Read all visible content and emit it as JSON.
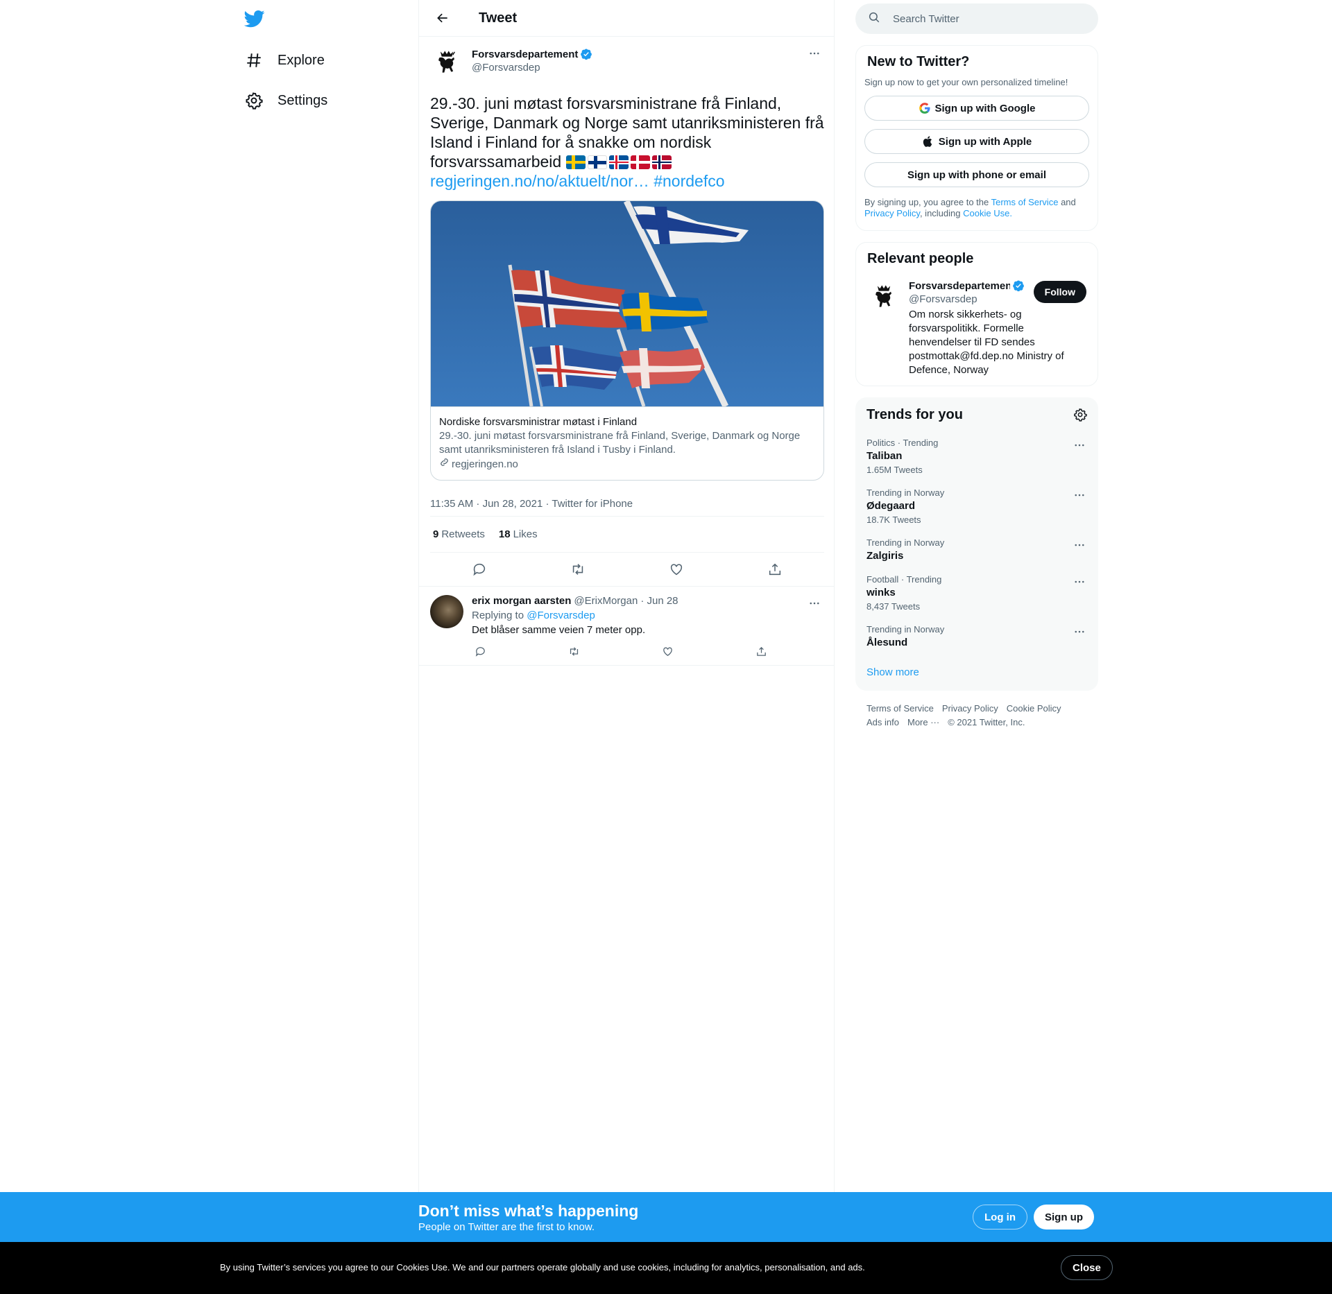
{
  "nav": {
    "items": [
      {
        "label": "Explore",
        "icon": "hashtag-icon"
      },
      {
        "label": "Settings",
        "icon": "gear-icon"
      }
    ]
  },
  "header": {
    "title": "Tweet"
  },
  "tweet": {
    "author_name": "Forsvarsdepartement",
    "author_handle": "@Forsvarsdep",
    "text": "29.-30. juni møtast forsvarsministrane frå Finland, Sverige, Danmark og Norge samt utanriksministeren frå Island i Finland for å snakke om nordisk forsvarssamarbeid",
    "link": "regjeringen.no/no/aktuelt/nor…",
    "hashtag": "#nordefco",
    "card": {
      "title": "Nordiske forsvarsministrar møtast i Finland",
      "description": "29.-30. juni møtast forsvarsministrane frå Finland, Sverige, Danmark og Norge samt utanriksministeren frå Island i Tusby i Finland.",
      "domain": "regjeringen.no"
    },
    "meta": "11:35 AM · Jun 28, 2021 · Twitter for iPhone",
    "retweets_count": "9",
    "retweets_label": "Retweets",
    "likes_count": "18",
    "likes_label": "Likes"
  },
  "reply": {
    "name": "erix morgan aarsten",
    "handle": "@ErixMorgan",
    "date": "· Jun 28",
    "replying_prefix": "Replying to",
    "replying_to": "@Forsvarsdep",
    "text": "Det blåser samme veien 7 meter opp."
  },
  "search": {
    "placeholder": "Search Twitter"
  },
  "signup": {
    "title": "New to Twitter?",
    "subtitle": "Sign up now to get your own personalized timeline!",
    "google": "Sign up with Google",
    "apple": "Sign up with Apple",
    "phone": "Sign up with phone or email",
    "terms_1": "By signing up, you agree to the",
    "terms_tos": "Terms of Service",
    "terms_and": "and",
    "terms_privacy": "Privacy Policy",
    "terms_including": ", including",
    "terms_cookie": "Cookie Use."
  },
  "relevant": {
    "title": "Relevant people",
    "name": "Forsvarsdepartement",
    "handle": "@Forsvarsdep",
    "bio": "Om norsk sikkerhets- og forsvarspolitikk. Formelle henvendelser til FD sendes postmottak@fd.dep.no Ministry of Defence, Norway",
    "follow": "Follow"
  },
  "trends": {
    "title": "Trends for you",
    "items": [
      {
        "category": "Politics · Trending",
        "name": "Taliban",
        "count": "1.65M Tweets"
      },
      {
        "category": "Trending in Norway",
        "name": "Ødegaard",
        "count": "18.7K Tweets"
      },
      {
        "category": "Trending in Norway",
        "name": "Zalgiris",
        "count": ""
      },
      {
        "category": "Football · Trending",
        "name": "winks",
        "count": "8,437 Tweets"
      },
      {
        "category": "Trending in Norway",
        "name": "Ålesund",
        "count": ""
      }
    ],
    "show_more": "Show more"
  },
  "footer": {
    "links": [
      "Terms of Service",
      "Privacy Policy",
      "Cookie Policy",
      "Ads info",
      "More ···",
      "© 2021 Twitter, Inc."
    ]
  },
  "banner": {
    "title": "Don’t miss what’s happening",
    "subtitle": "People on Twitter are the first to know.",
    "login": "Log in",
    "signup": "Sign up"
  },
  "cookie": {
    "text": "By using Twitter’s services you agree to our Cookies Use. We and our partners operate globally and use cookies, including for analytics, personalisation, and ads.",
    "close": "Close"
  },
  "colors": {
    "accent": "#1d9bf0",
    "text": "#0f1419",
    "secondary": "#536471"
  }
}
